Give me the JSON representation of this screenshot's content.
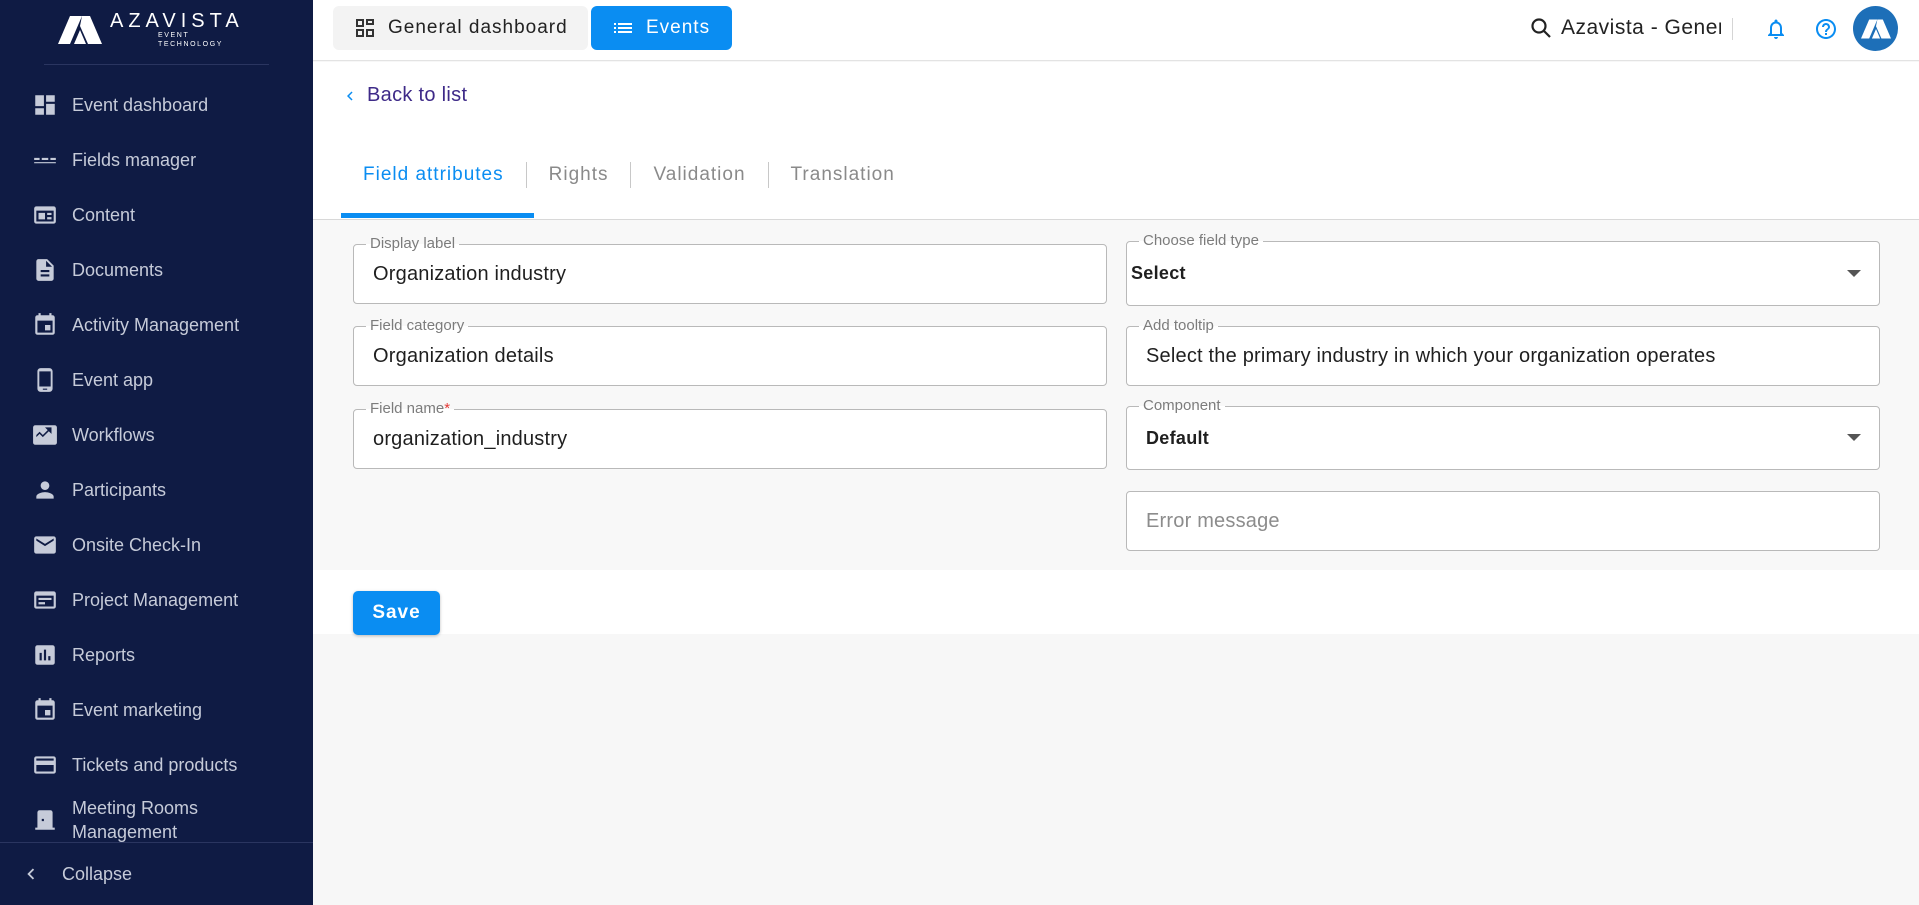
{
  "brand": {
    "name": "AZAVISTA",
    "tagline": "EVENT TECHNOLOGY"
  },
  "sidebar": {
    "items": [
      {
        "label": "Event dashboard",
        "icon": "dashboard-icon"
      },
      {
        "label": "Fields manager",
        "icon": "fields-icon"
      },
      {
        "label": "Content",
        "icon": "content-icon"
      },
      {
        "label": "Documents",
        "icon": "document-icon"
      },
      {
        "label": "Activity Management",
        "icon": "calendar-icon"
      },
      {
        "label": "Event app",
        "icon": "phone-icon"
      },
      {
        "label": "Workflows",
        "icon": "workflow-icon"
      },
      {
        "label": "Participants",
        "icon": "person-icon"
      },
      {
        "label": "Onsite Check-In",
        "icon": "mail-icon"
      },
      {
        "label": "Project Management",
        "icon": "project-icon"
      },
      {
        "label": "Reports",
        "icon": "reports-icon"
      },
      {
        "label": "Event marketing",
        "icon": "calendar-icon"
      },
      {
        "label": "Tickets and products",
        "icon": "card-icon"
      },
      {
        "label": "Meeting Rooms Management",
        "icon": "door-icon"
      }
    ],
    "collapse_label": "Collapse"
  },
  "topbar": {
    "general_dashboard_label": "General dashboard",
    "events_label": "Events",
    "search_text": "Azavista - Gener"
  },
  "page": {
    "back_label": "Back to list",
    "tabs": [
      {
        "label": "Field attributes",
        "active": true
      },
      {
        "label": "Rights",
        "active": false
      },
      {
        "label": "Validation",
        "active": false
      },
      {
        "label": "Translation",
        "active": false
      }
    ]
  },
  "form": {
    "display_label": {
      "label": "Display label",
      "value": "Organization industry"
    },
    "field_category": {
      "label": "Field category",
      "value": "Organization details"
    },
    "field_name": {
      "label": "Field name",
      "required_mark": "*",
      "value": "organization_industry"
    },
    "field_type": {
      "label": "Choose field type",
      "value": "Select"
    },
    "tooltip": {
      "label": "Add tooltip",
      "value": "Select the primary industry in which your organization operates"
    },
    "component": {
      "label": "Component",
      "value": "Default"
    },
    "error_message": {
      "placeholder": "Error message"
    },
    "save_label": "Save"
  },
  "colors": {
    "sidebar_bg": "#0f1b44",
    "accent": "#0a8df2",
    "back_link": "#3e2a88"
  }
}
